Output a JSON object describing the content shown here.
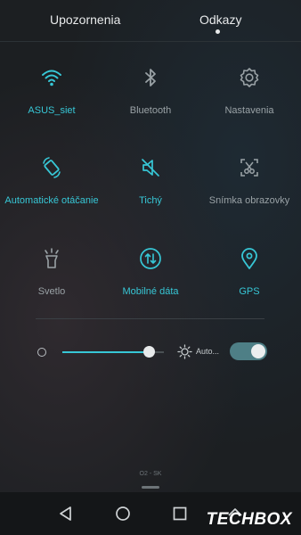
{
  "tabs": {
    "notifications": "Upozornenia",
    "shortcuts": "Odkazy"
  },
  "tiles": [
    {
      "label": "ASUS_siet",
      "icon": "wifi-icon",
      "state": "on"
    },
    {
      "label": "Bluetooth",
      "icon": "bluetooth-icon",
      "state": "off"
    },
    {
      "label": "Nastavenia",
      "icon": "gear-icon",
      "state": "off"
    },
    {
      "label": "Automatické otáčanie",
      "icon": "auto-rotate-icon",
      "state": "on"
    },
    {
      "label": "Tichý",
      "icon": "silent-icon",
      "state": "on"
    },
    {
      "label": "Snímka obrazovky",
      "icon": "screenshot-icon",
      "state": "off"
    },
    {
      "label": "Svetlo",
      "icon": "flashlight-icon",
      "state": "off"
    },
    {
      "label": "Mobilné dáta",
      "icon": "mobile-data-icon",
      "state": "on"
    },
    {
      "label": "GPS",
      "icon": "location-pin-icon",
      "state": "on"
    }
  ],
  "brightness": {
    "level": 0.85,
    "auto_label": "Auto...",
    "auto_enabled": true
  },
  "carrier": "O2 - SK",
  "watermark": "TECHBOX",
  "colors": {
    "accent": "#37c7d6",
    "inactive": "#9aa2a6",
    "background": "#1c1f22"
  }
}
